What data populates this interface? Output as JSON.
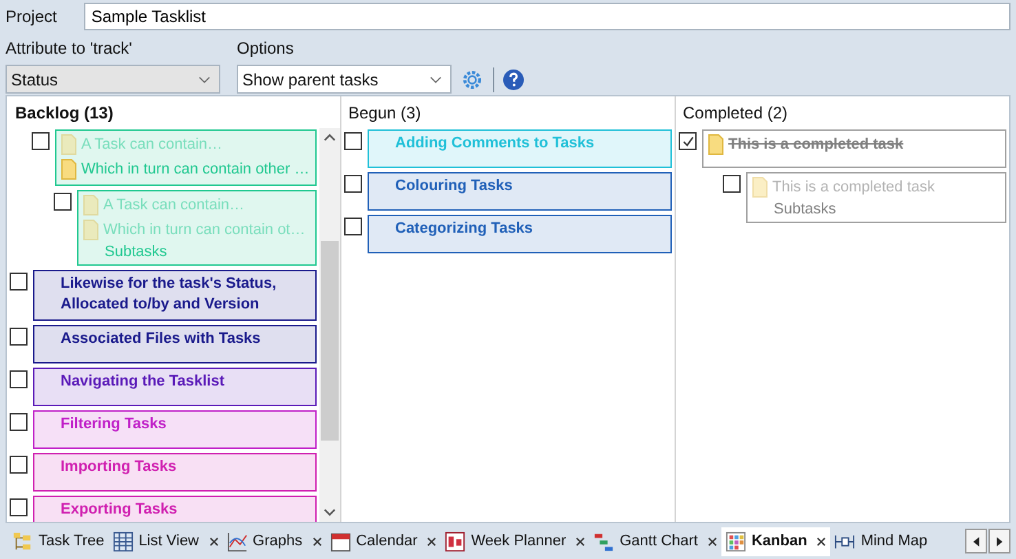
{
  "project": {
    "label": "Project",
    "value": "Sample Tasklist"
  },
  "attribute": {
    "label": "Attribute to 'track'",
    "value": "Status"
  },
  "options": {
    "label": "Options",
    "value": "Show parent tasks"
  },
  "columns": [
    {
      "title": "Backlog",
      "count": "(13)",
      "selected": true,
      "cards": [
        {
          "kind": "subtask",
          "checked": false,
          "done": false,
          "color": "#20c890",
          "lines": [
            {
              "kind": "parent",
              "text": "A Task can contain…"
            },
            {
              "kind": "task",
              "text": "Which in turn can contain other …"
            }
          ],
          "children": [
            {
              "kind": "subtask",
              "checked": false,
              "done": false,
              "color": "#20c890",
              "lines": [
                {
                  "kind": "parent",
                  "text": "A Task can contain…"
                },
                {
                  "kind": "parent",
                  "text": "Which in turn can contain ot…"
                },
                {
                  "kind": "subtask",
                  "text": "Subtasks"
                }
              ]
            }
          ]
        },
        {
          "kind": "task",
          "checked": false,
          "done": false,
          "color": "#1a1a8c",
          "lines": [
            {
              "kind": "title",
              "text": "Likewise for the task's Status, Allocated to/by and Version"
            }
          ]
        },
        {
          "kind": "task",
          "checked": false,
          "done": false,
          "color": "#1a1a8c",
          "lines": [
            {
              "kind": "title",
              "text": "Associated Files with Tasks"
            }
          ]
        },
        {
          "kind": "task",
          "checked": false,
          "done": false,
          "color": "#5a1ab8",
          "lines": [
            {
              "kind": "title",
              "text": "Navigating the Tasklist"
            }
          ]
        },
        {
          "kind": "task",
          "checked": false,
          "done": false,
          "color": "#c020c8",
          "lines": [
            {
              "kind": "title",
              "text": "Filtering Tasks"
            }
          ]
        },
        {
          "kind": "task",
          "checked": false,
          "done": false,
          "color": "#d020b0",
          "lines": [
            {
              "kind": "title",
              "text": "Importing Tasks"
            }
          ]
        },
        {
          "kind": "task",
          "checked": false,
          "done": false,
          "color": "#d020b0",
          "lines": [
            {
              "kind": "title",
              "text": "Exporting Tasks"
            }
          ]
        }
      ]
    },
    {
      "title": "Begun",
      "count": "(3)",
      "selected": false,
      "cards": [
        {
          "kind": "task",
          "checked": false,
          "done": false,
          "color": "#20c0d8",
          "lines": [
            {
              "kind": "title",
              "text": "Adding Comments to Tasks"
            }
          ]
        },
        {
          "kind": "task",
          "checked": false,
          "done": false,
          "color": "#2060b8",
          "lines": [
            {
              "kind": "title",
              "text": "Colouring Tasks"
            }
          ]
        },
        {
          "kind": "task",
          "checked": false,
          "done": false,
          "color": "#2060b8",
          "lines": [
            {
              "kind": "title",
              "text": "Categorizing Tasks"
            }
          ]
        }
      ]
    },
    {
      "title": "Completed",
      "count": "(2)",
      "selected": false,
      "cards": [
        {
          "kind": "task",
          "checked": true,
          "done": true,
          "color": "#808080",
          "lines": [
            {
              "kind": "title",
              "text": "This is a completed task"
            }
          ],
          "children": [
            {
              "kind": "subtask",
              "checked": false,
              "done": true,
              "color": "#808080",
              "lines": [
                {
                  "kind": "parent",
                  "text": "This is a completed task"
                },
                {
                  "kind": "subtask",
                  "text": "Subtasks"
                }
              ]
            }
          ]
        }
      ]
    }
  ],
  "tabs": [
    {
      "label": "Task Tree",
      "closable": false,
      "selected": false
    },
    {
      "label": "List View",
      "closable": true,
      "selected": false
    },
    {
      "label": "Graphs",
      "closable": true,
      "selected": false
    },
    {
      "label": "Calendar",
      "closable": true,
      "selected": false
    },
    {
      "label": "Week Planner",
      "closable": true,
      "selected": false
    },
    {
      "label": "Gantt Chart",
      "closable": true,
      "selected": false
    },
    {
      "label": "Kanban",
      "closable": true,
      "selected": true
    },
    {
      "label": "Mind Map",
      "closable": false,
      "selected": false
    }
  ]
}
